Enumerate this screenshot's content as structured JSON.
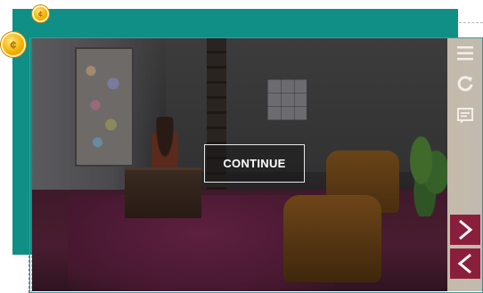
{
  "overlay": {
    "continue_label": "CONTINUE"
  },
  "icons": {
    "coin_small": "coin-icon",
    "coin_large": "coin-icon",
    "menu": "hamburger-menu-icon",
    "replay": "replay-icon",
    "notes": "notes-icon",
    "next": "chevron-right-icon",
    "previous": "chevron-left-icon"
  },
  "colors": {
    "frame_teal": "#0f8f86",
    "nav_accent": "#8a1f3c",
    "coin": "#f4b400"
  }
}
